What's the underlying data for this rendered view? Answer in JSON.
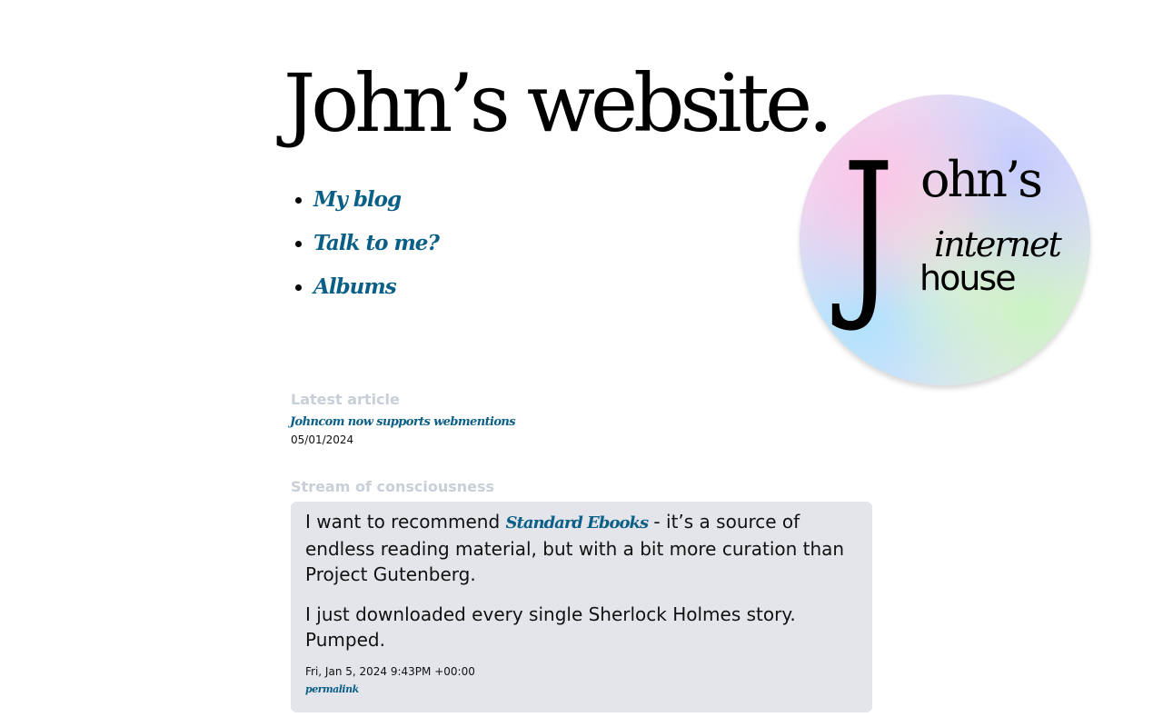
{
  "header": {
    "title": "John’s website."
  },
  "nav": {
    "items": [
      {
        "label": "My blog"
      },
      {
        "label": "Talk to me?"
      },
      {
        "label": "Albums"
      }
    ]
  },
  "logo": {
    "icon": "johns-internet-house-logo",
    "line1": "John’s",
    "line2": "internet",
    "line3": "house"
  },
  "latest": {
    "heading": "Latest article",
    "title": "Johncom now supports webmentions",
    "date": "05/01/2024"
  },
  "stream": {
    "heading": "Stream of consciousness",
    "post": {
      "text_before": "I want to recommend ",
      "link": "Standard Ebooks",
      "text_after": " - it’s a source of endless reading material, but with a bit more curation than Project Gutenberg.",
      "paragraph2": "I just downloaded every single Sherlock Holmes story. Pumped.",
      "timestamp": "Fri, Jan 5, 2024 9:43PM +00:00",
      "permalink": "permalink"
    }
  },
  "colors": {
    "link": "#0a5f87",
    "section_label": "#c9cfd8",
    "card_bg": "#e4e5ea"
  }
}
